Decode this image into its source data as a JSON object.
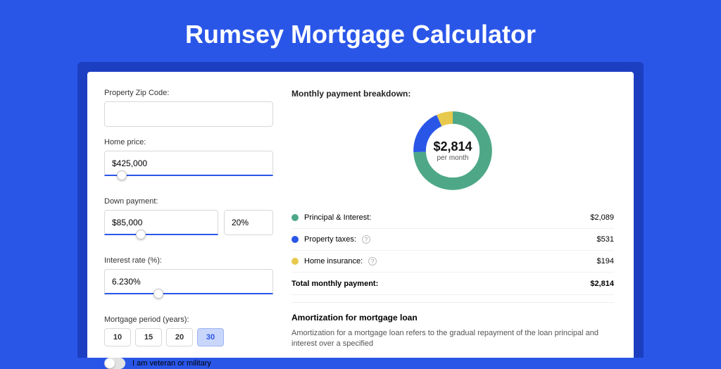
{
  "title": "Rumsey Mortgage Calculator",
  "form": {
    "zip_label": "Property Zip Code:",
    "zip_value": "",
    "home_price_label": "Home price:",
    "home_price_value": "$425,000",
    "down_payment_label": "Down payment:",
    "down_payment_value": "$85,000",
    "down_payment_pct": "20%",
    "interest_label": "Interest rate (%):",
    "interest_value": "6.230%",
    "period_label": "Mortgage period (years):",
    "period_options": [
      "10",
      "15",
      "20",
      "30"
    ],
    "period_selected": "30",
    "veteran_label": "I am veteran or military"
  },
  "breakdown": {
    "heading": "Monthly payment breakdown:",
    "center_amount": "$2,814",
    "center_sub": "per month",
    "items": {
      "pi": {
        "label": "Principal & Interest:",
        "value": "$2,089"
      },
      "tax": {
        "label": "Property taxes:",
        "value": "$531"
      },
      "ins": {
        "label": "Home insurance:",
        "value": "$194"
      }
    },
    "total_label": "Total monthly payment:",
    "total_value": "$2,814"
  },
  "amortization": {
    "heading": "Amortization for mortgage loan",
    "body": "Amortization for a mortgage loan refers to the gradual repayment of the loan principal and interest over a specified"
  },
  "chart_data": {
    "type": "pie",
    "title": "Monthly payment breakdown",
    "series": [
      {
        "name": "Principal & Interest",
        "value": 2089,
        "color": "#4ea887"
      },
      {
        "name": "Property taxes",
        "value": 531,
        "color": "#2a56e8"
      },
      {
        "name": "Home insurance",
        "value": 194,
        "color": "#e7c94d"
      }
    ],
    "total": 2814
  }
}
